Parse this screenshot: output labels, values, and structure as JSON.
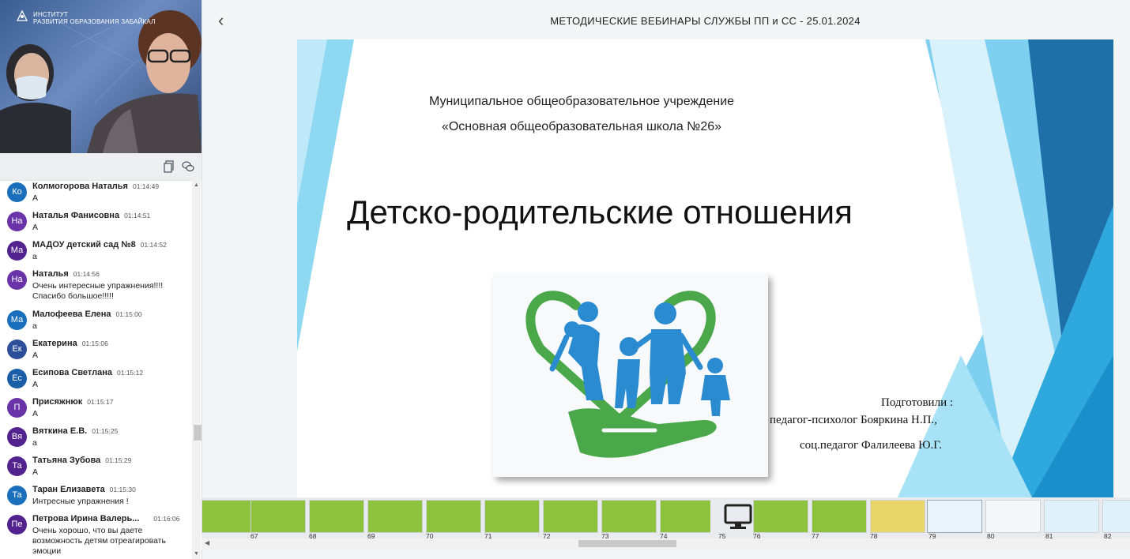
{
  "app": {
    "title": "МЕТОДИЧЕСКИЕ ВЕБИНАРЫ СЛУЖБЫ ПП и СС - 25.01.2024"
  },
  "video": {
    "logo_line1": "ИНСТИТУТ",
    "logo_line2": "РАЗВИТИЯ ОБРАЗОВАНИЯ ЗАБАЙКАЛ"
  },
  "chat": {
    "messages": [
      {
        "initials": "Ко",
        "name": "Колмогорова Наталья",
        "time": "01:14:49",
        "text": "А",
        "color": "#1a6fbd"
      },
      {
        "initials": "На",
        "name": "Наталья Фанисовна",
        "time": "01:14:51",
        "text": "А",
        "color": "#6a34a8"
      },
      {
        "initials": "Ма",
        "name": "МАДОУ детский сад №8",
        "time": "01:14:52",
        "text": "а",
        "color": "#52238f"
      },
      {
        "initials": "На",
        "name": "Наталья",
        "time": "01:14:56",
        "text": "Очень интересные упражнения!!!! Спасибо большое!!!!!",
        "color": "#6a34a8"
      },
      {
        "initials": "Ма",
        "name": "Малофеева Елена",
        "time": "01:15:00",
        "text": "а",
        "color": "#1a6fbd"
      },
      {
        "initials": "Ек",
        "name": "Екатерина",
        "time": "01:15:06",
        "text": "А",
        "color": "#2d4f9a"
      },
      {
        "initials": "Ес",
        "name": "Есипова Светлана",
        "time": "01:15:12",
        "text": "А",
        "color": "#1a5ea8"
      },
      {
        "initials": "П",
        "name": "Присяжнюк",
        "time": "01:15:17",
        "text": "А",
        "color": "#6a34a8"
      },
      {
        "initials": "Вя",
        "name": "Вяткина Е.В.",
        "time": "01:15:25",
        "text": "а",
        "color": "#52238f"
      },
      {
        "initials": "Та",
        "name": "Татьяна Зубова",
        "time": "01:15:29",
        "text": "А",
        "color": "#52238f"
      },
      {
        "initials": "Та",
        "name": "Таран Елизавета",
        "time": "01:15:30",
        "text": "Интресные упражнения !",
        "color": "#1a6fbd"
      },
      {
        "initials": "Пе",
        "name": "Петрова Ирина Валерь...",
        "time": "01:16:06",
        "text": "Очень хорошо, что вы даете возможность детям отреагировать эмоции",
        "color": "#52238f"
      }
    ]
  },
  "slide": {
    "line1": "Муниципальное общеобразовательное учреждение",
    "line2": "«Основная общеобразовательная школа №26»",
    "title": "Детско-родительские отношения",
    "authors_label": "Подготовили :",
    "author1": "педагог-психолог Бояркина Н.П.,",
    "author2": "соц.педагог Фалилеева Ю.Г.",
    "colors": {
      "light_blue": "#8fd8f2",
      "mid_blue": "#2fa8de",
      "dark_blue": "#1f6fa8",
      "green": "#4aa84a",
      "figure_blue": "#2a8bd0"
    }
  },
  "thumbnails": [
    {
      "num": "",
      "color": "#8dc23f"
    },
    {
      "num": "67",
      "color": "#8dc23f"
    },
    {
      "num": "68",
      "color": "#8dc23f"
    },
    {
      "num": "69",
      "color": "#8dc23f"
    },
    {
      "num": "70",
      "color": "#8dc23f"
    },
    {
      "num": "71",
      "color": "#8dc23f"
    },
    {
      "num": "72",
      "color": "#8dc23f"
    },
    {
      "num": "73",
      "color": "#8dc23f"
    },
    {
      "num": "74",
      "color": "#8dc23f"
    },
    {
      "num": "75",
      "color": "#ffffff"
    },
    {
      "num": "76",
      "color": "#8dc23f"
    },
    {
      "num": "77",
      "color": "#8dc23f"
    },
    {
      "num": "78",
      "color": "#e7d76a"
    },
    {
      "num": "79",
      "color": "#eaf4fb"
    },
    {
      "num": "80",
      "color": "#f4f8fb"
    },
    {
      "num": "81",
      "color": "#dff1fb"
    },
    {
      "num": "82",
      "color": "#dff1fb"
    }
  ]
}
